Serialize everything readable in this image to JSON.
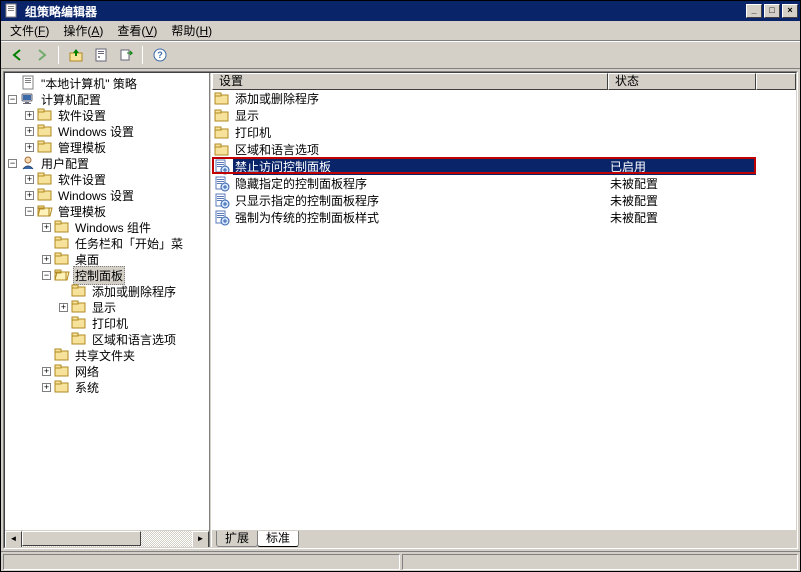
{
  "window": {
    "title": "组策略编辑器"
  },
  "menus": {
    "file": {
      "label": "文件",
      "key": "F"
    },
    "action": {
      "label": "操作",
      "key": "A"
    },
    "view": {
      "label": "查看",
      "key": "V"
    },
    "help": {
      "label": "帮助",
      "key": "H"
    }
  },
  "tree": {
    "root": "\"本地计算机\" 策略",
    "computer_cfg": "计算机配置",
    "software_settings": "软件设置",
    "windows_settings": "Windows 设置",
    "admin_templates": "管理模板",
    "user_cfg": "用户配置",
    "windows_components": "Windows 组件",
    "taskbar_start": "任务栏和「开始」菜",
    "desktop": "桌面",
    "control_panel": "控制面板",
    "add_remove": "添加或删除程序",
    "display": "显示",
    "printers": "打印机",
    "region_lang": "区域和语言选项",
    "shared_folders": "共享文件夹",
    "network": "网络",
    "system": "系统"
  },
  "list": {
    "col_setting": "设置",
    "col_state": "状态",
    "rows": [
      {
        "icon": "folder",
        "name": "添加或删除程序",
        "state": ""
      },
      {
        "icon": "folder",
        "name": "显示",
        "state": ""
      },
      {
        "icon": "folder",
        "name": "打印机",
        "state": ""
      },
      {
        "icon": "folder",
        "name": "区域和语言选项",
        "state": ""
      },
      {
        "icon": "policy",
        "name": "禁止访问控制面板",
        "state": "已启用",
        "selected": true,
        "highlight": true
      },
      {
        "icon": "policy",
        "name": "隐藏指定的控制面板程序",
        "state": "未被配置"
      },
      {
        "icon": "policy",
        "name": "只显示指定的控制面板程序",
        "state": "未被配置"
      },
      {
        "icon": "policy",
        "name": "强制为传统的控制面板样式",
        "state": "未被配置"
      }
    ]
  },
  "tabs": {
    "extended": "扩展",
    "standard": "标准"
  },
  "layout": {
    "col0_width": 396,
    "col1_width": 148
  }
}
